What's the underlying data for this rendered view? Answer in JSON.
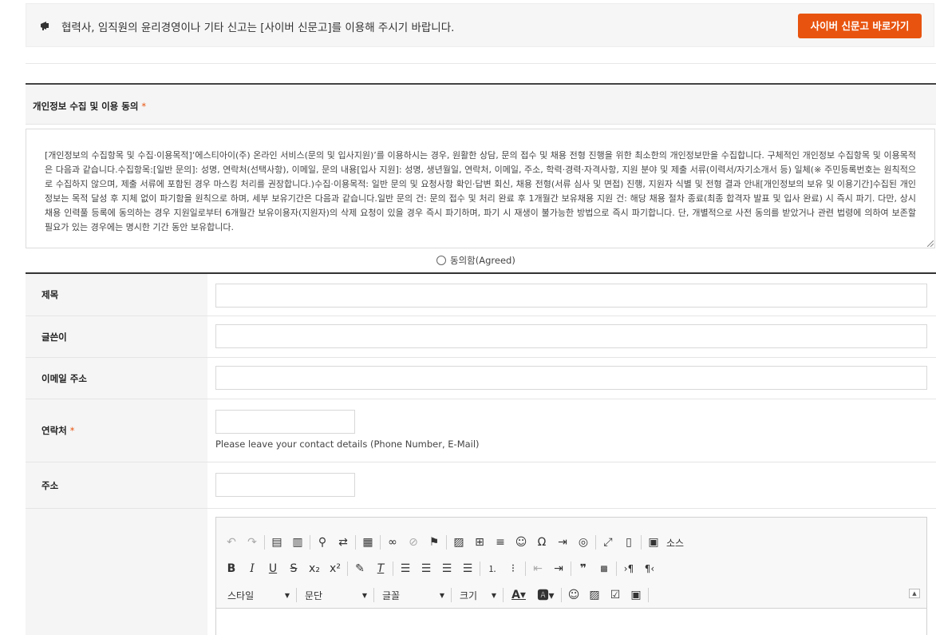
{
  "notice": {
    "icon": "megaphone-icon",
    "text": "협력사, 임직원의 윤리경영이나 기타 신고는 [사이버 신문고]를 이용해 주시기 바랍니다.",
    "button_label": "사이버 신문고 바로가기",
    "button_color": "#e8540f"
  },
  "privacy": {
    "title": "개인정보 수집 및 이용 동의",
    "required_mark": "*",
    "body": "[개인정보의 수집항목 및 수집·이용목적]‘에스티아이(주) 온라인 서비스(문의 및 입사지원)’를 이용하시는 경우, 원활한 상담, 문의 접수 및 채용 전형 진행을 위한 최소한의 개인정보만을 수집합니다. 구체적인 개인정보 수집항목 및 이용목적은 다음과 같습니다.수집항목:[일반 문의]: 성명, 연락처(선택사항), 이메일, 문의 내용[입사 지원]: 성명, 생년월일, 연락처, 이메일, 주소, 학력·경력·자격사항, 지원 분야 및 제출 서류(이력서/자기소개서 등) 일체(※ 주민등록번호는 원칙적으로 수집하지 않으며, 제출 서류에 포함된 경우 마스킹 처리를 권장합니다.)수집·이용목적: 일반 문의 및 요청사항 확인·답변 회신, 채용 전형(서류 심사 및 면접) 진행, 지원자 식별 및 전형 결과 안내[개인정보의 보유 및 이용기간]수집된 개인정보는 목적 달성 후 지체 없이 파기함을 원칙으로 하며, 세부 보유기간은 다음과 같습니다.일반 문의 건: 문의 접수 및 처리 완료 후 1개월간 보유채용 지원 건: 해당 채용 절차 종료(최종 합격자 발표 및 입사 완료) 시 즉시 파기. 다만, 상시 채용 인력풀 등록에 동의하는 경우 지원일로부터 6개월간 보유이용자(지원자)의 삭제 요청이 있을 경우 즉시 파기하며, 파기 시 재생이 불가능한 방법으로 즉시 파기합니다. 단, 개별적으로 사전 동의를 받았거나 관련 법령에 의하여 보존할 필요가 있는 경우에는 명시한 기간 동안 보유합니다.",
    "agree_label": "동의함(Agreed)"
  },
  "form": {
    "subject_label": "제목",
    "author_label": "글쓴이",
    "email_label": "이메일 주소",
    "contact_label": "연락처",
    "contact_required": "*",
    "contact_hint": "Please leave your contact details (Phone Number, E-Mail)",
    "address_label": "주소"
  },
  "editor": {
    "source_label": "소스",
    "style_label": "스타일",
    "paragraph_label": "문단",
    "font_label": "글꼴",
    "size_label": "크기",
    "icons_row1": [
      "undo-icon",
      "redo-icon",
      "paste-text-icon",
      "paste-word-icon",
      "find-icon",
      "replace-icon",
      "template-icon",
      "link-icon",
      "unlink-icon",
      "anchor-icon",
      "image-icon",
      "table-icon",
      "horizontal-rule-icon",
      "smiley-icon",
      "special-char-icon",
      "page-break-icon",
      "iframe-icon",
      "maximize-icon",
      "show-blocks-icon",
      "source-icon"
    ],
    "icons_row2": [
      "bold-icon",
      "italic-icon",
      "underline-icon",
      "strike-icon",
      "subscript-icon",
      "superscript-icon",
      "copy-format-icon",
      "remove-format-icon",
      "align-left-icon",
      "align-center-icon",
      "align-right-icon",
      "align-justify-icon",
      "numbered-list-icon",
      "bulleted-list-icon",
      "outdent-icon",
      "indent-icon",
      "blockquote-icon",
      "div-icon",
      "ltr-icon",
      "rtl-icon"
    ]
  }
}
